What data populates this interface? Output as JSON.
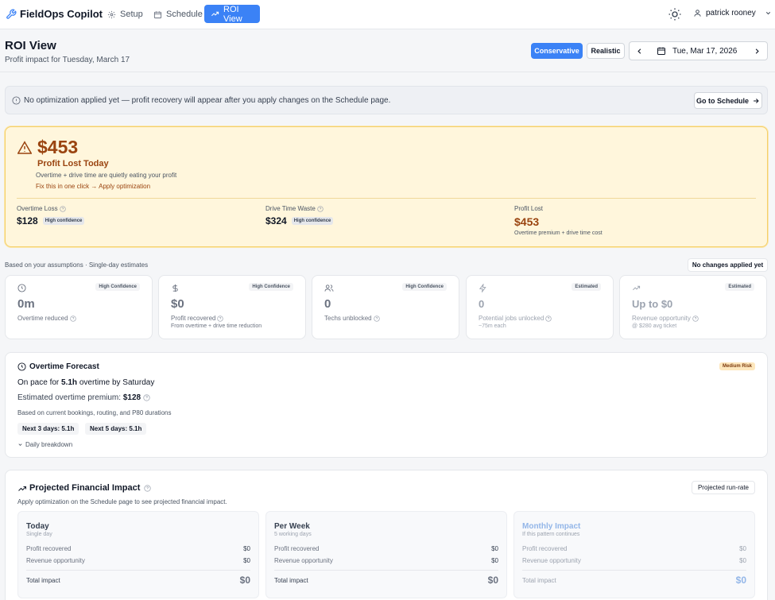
{
  "app": {
    "name": "FieldOps Copilot",
    "nav": [
      {
        "label": "Setup",
        "icon": "gear-icon"
      },
      {
        "label": "Schedule",
        "icon": "calendar-icon"
      },
      {
        "label": "ROI View",
        "icon": "trending-up-icon",
        "active": true
      }
    ],
    "user": "patrick rooney"
  },
  "header": {
    "title": "ROI View",
    "subtitle": "Profit impact for Tuesday, March 17",
    "mode_conservative": "Conservative",
    "mode_realistic": "Realistic",
    "date": "Tue, Mar 17, 2026"
  },
  "banner": {
    "text": "No optimization applied yet — profit recovery will appear after you apply changes on the Schedule page.",
    "button": "Go to Schedule"
  },
  "loss": {
    "amount": "$453",
    "label": "Profit Lost Today",
    "desc": "Overtime + drive time are quietly eating your profit",
    "fix": "Fix this in one click → Apply optimization",
    "metrics": [
      {
        "label": "Overtime Loss",
        "value": "$128",
        "badge": "High confidence"
      },
      {
        "label": "Drive Time Waste",
        "value": "$324",
        "badge": "High confidence"
      },
      {
        "label": "Profit Lost",
        "value": "$453",
        "note": "Overtime premium + drive time cost"
      }
    ]
  },
  "assumptions": {
    "text": "Based on your assumptions · Single-day estimates",
    "status": "No changes applied yet"
  },
  "stats": [
    {
      "icon": "clock-icon",
      "badge": "High Confidence",
      "value": "0m",
      "label": "Overtime reduced",
      "note": ""
    },
    {
      "icon": "dollar-icon",
      "badge": "High Confidence",
      "value": "$0",
      "label": "Profit recovered",
      "note": "From overtime + drive time reduction"
    },
    {
      "icon": "users-icon",
      "badge": "High Confidence",
      "value": "0",
      "label": "Techs unblocked",
      "note": ""
    },
    {
      "icon": "bolt-icon",
      "badge": "Estimated",
      "value": "0",
      "label": "Potential jobs unlocked",
      "note": "~75m each"
    },
    {
      "icon": "trending-up-icon",
      "badge": "Estimated",
      "value": "Up to $0",
      "label": "Revenue opportunity",
      "note": "@ $280 avg ticket"
    }
  ],
  "forecast": {
    "title": "Overtime Forecast",
    "risk": "Medium Risk",
    "pace_prefix": "On pace for ",
    "pace_hours": "5.1h",
    "pace_suffix": " overtime by Saturday",
    "premium_label": "Estimated overtime premium: ",
    "premium_value": "$128",
    "basis": "Based on current bookings, routing, and P80 durations",
    "chips": [
      "Next 3 days: 5.1h",
      "Next 5 days: 5.1h"
    ],
    "toggle": "Daily breakdown"
  },
  "impact": {
    "title": "Projected Financial Impact",
    "runrate": "Projected run-rate",
    "desc": "Apply optimization on the Schedule page to see projected financial impact.",
    "periods": [
      {
        "title": "Today",
        "sub": "Single day",
        "profit_label": "Profit recovered",
        "profit": "$0",
        "revenue_label": "Revenue opportunity",
        "revenue": "$0",
        "total_label": "Total impact",
        "total": "$0"
      },
      {
        "title": "Per Week",
        "sub": "5 working days",
        "profit_label": "Profit recovered",
        "profit": "$0",
        "revenue_label": "Revenue opportunity",
        "revenue": "$0",
        "total_label": "Total impact",
        "total": "$0"
      },
      {
        "title": "Monthly Impact",
        "sub": "If this pattern continues",
        "profit_label": "Profit recovered",
        "profit": "$0",
        "revenue_label": "Revenue opportunity",
        "revenue": "$0",
        "total_label": "Total impact",
        "total": "$0"
      }
    ]
  },
  "colors": {
    "accent": "#3b82f6",
    "loss": "#9a4410",
    "warning_bg": "#fff6dc"
  }
}
